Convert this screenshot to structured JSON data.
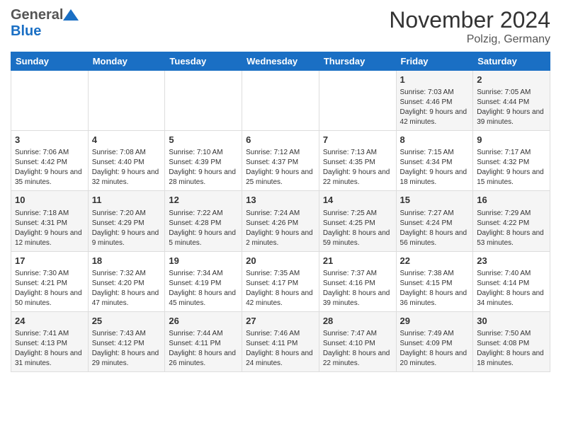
{
  "header": {
    "logo_general": "General",
    "logo_blue": "Blue",
    "title": "November 2024",
    "subtitle": "Polzig, Germany"
  },
  "weekdays": [
    "Sunday",
    "Monday",
    "Tuesday",
    "Wednesday",
    "Thursday",
    "Friday",
    "Saturday"
  ],
  "weeks": [
    [
      {
        "day": "",
        "info": ""
      },
      {
        "day": "",
        "info": ""
      },
      {
        "day": "",
        "info": ""
      },
      {
        "day": "",
        "info": ""
      },
      {
        "day": "",
        "info": ""
      },
      {
        "day": "1",
        "info": "Sunrise: 7:03 AM\nSunset: 4:46 PM\nDaylight: 9 hours and 42 minutes."
      },
      {
        "day": "2",
        "info": "Sunrise: 7:05 AM\nSunset: 4:44 PM\nDaylight: 9 hours and 39 minutes."
      }
    ],
    [
      {
        "day": "3",
        "info": "Sunrise: 7:06 AM\nSunset: 4:42 PM\nDaylight: 9 hours and 35 minutes."
      },
      {
        "day": "4",
        "info": "Sunrise: 7:08 AM\nSunset: 4:40 PM\nDaylight: 9 hours and 32 minutes."
      },
      {
        "day": "5",
        "info": "Sunrise: 7:10 AM\nSunset: 4:39 PM\nDaylight: 9 hours and 28 minutes."
      },
      {
        "day": "6",
        "info": "Sunrise: 7:12 AM\nSunset: 4:37 PM\nDaylight: 9 hours and 25 minutes."
      },
      {
        "day": "7",
        "info": "Sunrise: 7:13 AM\nSunset: 4:35 PM\nDaylight: 9 hours and 22 minutes."
      },
      {
        "day": "8",
        "info": "Sunrise: 7:15 AM\nSunset: 4:34 PM\nDaylight: 9 hours and 18 minutes."
      },
      {
        "day": "9",
        "info": "Sunrise: 7:17 AM\nSunset: 4:32 PM\nDaylight: 9 hours and 15 minutes."
      }
    ],
    [
      {
        "day": "10",
        "info": "Sunrise: 7:18 AM\nSunset: 4:31 PM\nDaylight: 9 hours and 12 minutes."
      },
      {
        "day": "11",
        "info": "Sunrise: 7:20 AM\nSunset: 4:29 PM\nDaylight: 9 hours and 9 minutes."
      },
      {
        "day": "12",
        "info": "Sunrise: 7:22 AM\nSunset: 4:28 PM\nDaylight: 9 hours and 5 minutes."
      },
      {
        "day": "13",
        "info": "Sunrise: 7:24 AM\nSunset: 4:26 PM\nDaylight: 9 hours and 2 minutes."
      },
      {
        "day": "14",
        "info": "Sunrise: 7:25 AM\nSunset: 4:25 PM\nDaylight: 8 hours and 59 minutes."
      },
      {
        "day": "15",
        "info": "Sunrise: 7:27 AM\nSunset: 4:24 PM\nDaylight: 8 hours and 56 minutes."
      },
      {
        "day": "16",
        "info": "Sunrise: 7:29 AM\nSunset: 4:22 PM\nDaylight: 8 hours and 53 minutes."
      }
    ],
    [
      {
        "day": "17",
        "info": "Sunrise: 7:30 AM\nSunset: 4:21 PM\nDaylight: 8 hours and 50 minutes."
      },
      {
        "day": "18",
        "info": "Sunrise: 7:32 AM\nSunset: 4:20 PM\nDaylight: 8 hours and 47 minutes."
      },
      {
        "day": "19",
        "info": "Sunrise: 7:34 AM\nSunset: 4:19 PM\nDaylight: 8 hours and 45 minutes."
      },
      {
        "day": "20",
        "info": "Sunrise: 7:35 AM\nSunset: 4:17 PM\nDaylight: 8 hours and 42 minutes."
      },
      {
        "day": "21",
        "info": "Sunrise: 7:37 AM\nSunset: 4:16 PM\nDaylight: 8 hours and 39 minutes."
      },
      {
        "day": "22",
        "info": "Sunrise: 7:38 AM\nSunset: 4:15 PM\nDaylight: 8 hours and 36 minutes."
      },
      {
        "day": "23",
        "info": "Sunrise: 7:40 AM\nSunset: 4:14 PM\nDaylight: 8 hours and 34 minutes."
      }
    ],
    [
      {
        "day": "24",
        "info": "Sunrise: 7:41 AM\nSunset: 4:13 PM\nDaylight: 8 hours and 31 minutes."
      },
      {
        "day": "25",
        "info": "Sunrise: 7:43 AM\nSunset: 4:12 PM\nDaylight: 8 hours and 29 minutes."
      },
      {
        "day": "26",
        "info": "Sunrise: 7:44 AM\nSunset: 4:11 PM\nDaylight: 8 hours and 26 minutes."
      },
      {
        "day": "27",
        "info": "Sunrise: 7:46 AM\nSunset: 4:11 PM\nDaylight: 8 hours and 24 minutes."
      },
      {
        "day": "28",
        "info": "Sunrise: 7:47 AM\nSunset: 4:10 PM\nDaylight: 8 hours and 22 minutes."
      },
      {
        "day": "29",
        "info": "Sunrise: 7:49 AM\nSunset: 4:09 PM\nDaylight: 8 hours and 20 minutes."
      },
      {
        "day": "30",
        "info": "Sunrise: 7:50 AM\nSunset: 4:08 PM\nDaylight: 8 hours and 18 minutes."
      }
    ]
  ]
}
